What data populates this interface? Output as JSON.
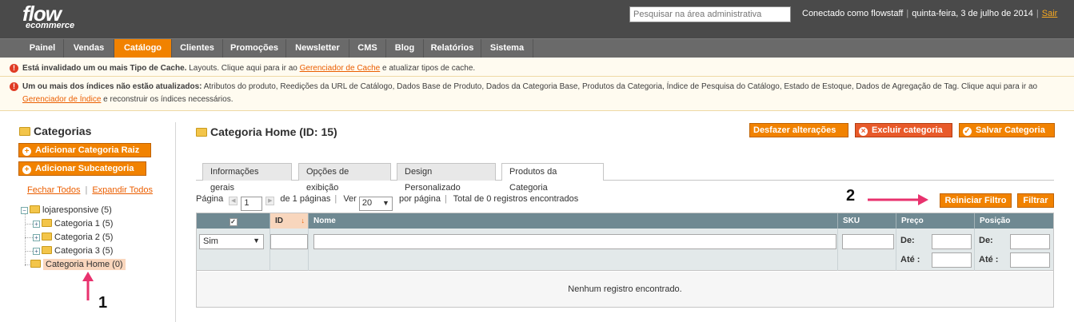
{
  "header": {
    "logo_main": "flow",
    "logo_sub": "ecommerce",
    "search_placeholder": "Pesquisar na área administrativa",
    "user_text": "Conectado como flowstaff",
    "date_text": "quinta-feira, 3 de julho de 2014",
    "logout_label": "Sair"
  },
  "nav": {
    "items": [
      {
        "label": "Painel"
      },
      {
        "label": "Vendas"
      },
      {
        "label": "Catálogo"
      },
      {
        "label": "Clientes"
      },
      {
        "label": "Promoções"
      },
      {
        "label": "Newsletter"
      },
      {
        "label": "CMS"
      },
      {
        "label": "Blog"
      },
      {
        "label": "Relatórios"
      },
      {
        "label": "Sistema"
      }
    ],
    "active_index": 2
  },
  "messages": {
    "cache": {
      "bold": "Está invalidado um ou mais Tipo de Cache.",
      "text": " Layouts. Clique aqui para ir ao ",
      "link": "Gerenciador de Cache",
      "after": " e atualizar tipos de cache."
    },
    "index": {
      "bold": "Um ou mais dos índices não estão atualizados:",
      "text": " Atributos do produto, Reedições da URL de Catálogo, Dados Base de Produto, Dados da Categoria Base, Produtos da Categoria, Índice de Pesquisa do Catálogo, Estado de Estoque, Dados de Agregação de Tag. Clique aqui para ir ao ",
      "link": "Gerenciador de Índice",
      "after": " e reconstruir os índices necessários."
    }
  },
  "sidebar": {
    "title": "Categorias",
    "add_root_label": "Adicionar Categoria Raiz",
    "add_sub_label": "Adicionar Subcategoria",
    "collapse_all_label": "Fechar Todos",
    "expand_all_label": "Expandir Todos",
    "tree": {
      "root": "lojaresponsive (5)",
      "children": [
        "Categoria 1 (5)",
        "Categoria 2 (5)",
        "Categoria 3 (5)",
        "Categoria Home (0)"
      ]
    }
  },
  "main": {
    "title": "Categoria Home (ID: 15)",
    "reset_label": "Desfazer alterações",
    "delete_label": "Excluir categoria",
    "save_label": "Salvar Categoria",
    "tabs": [
      {
        "label": "Informações gerais"
      },
      {
        "label": "Opções de exibição"
      },
      {
        "label": "Design Personalizado"
      },
      {
        "label": "Produtos da Categoria"
      }
    ],
    "active_tab": 3
  },
  "pager": {
    "page_label": "Página",
    "page_value": "1",
    "of_pages": "de 1 páginas",
    "view_label": "Ver",
    "per_page_value": "20",
    "per_page_label": "por página",
    "total_text": "Total de 0 registros encontrados",
    "reset_filter_label": "Reiniciar Filtro",
    "filter_label": "Filtrar"
  },
  "grid": {
    "columns": [
      "",
      "ID",
      "Nome",
      "SKU",
      "Preço",
      "Posição"
    ],
    "filter_in_category": "Sim",
    "from_label": "De:",
    "to_label": "Até :",
    "empty_text": "Nenhum registro encontrado."
  },
  "annotations": {
    "one": "1",
    "two": "2",
    "arrow_color": "#e8326e"
  }
}
